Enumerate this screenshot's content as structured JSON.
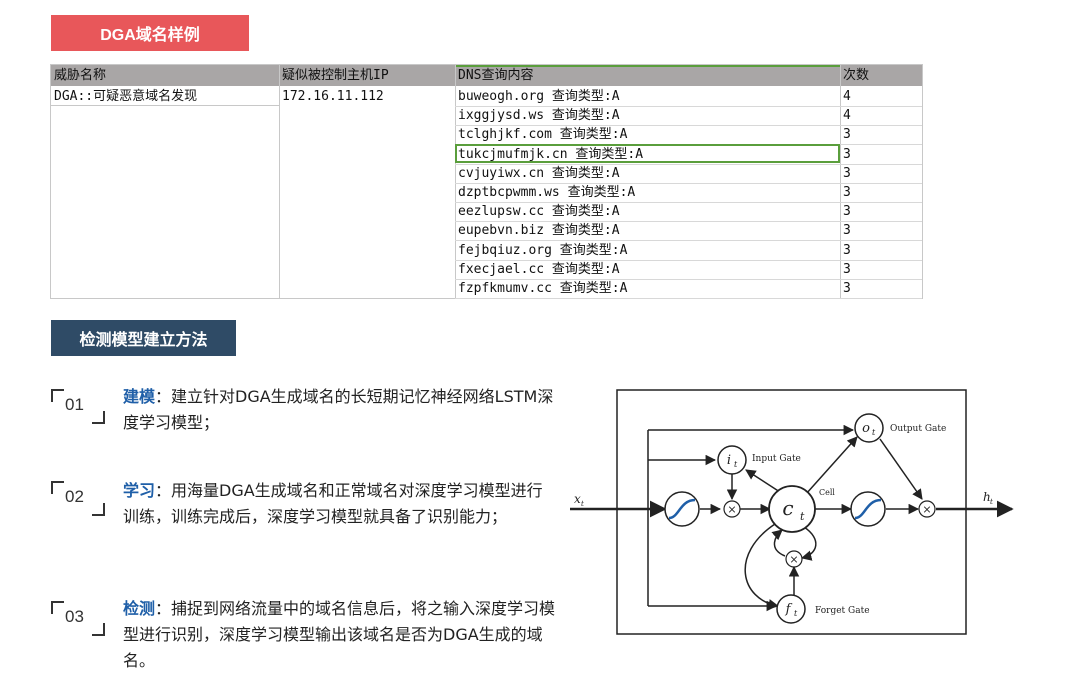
{
  "section1": {
    "title": "DGA域名样例"
  },
  "section2": {
    "title": "检测模型建立方法"
  },
  "table": {
    "headers": [
      "威胁名称",
      "疑似被控制主机IP",
      "DNS查询内容",
      "次数"
    ],
    "threat_name": "DGA::可疑恶意域名发现",
    "host_ip": "172.16.11.112",
    "rows": [
      {
        "query": "buweogh.org 查询类型:A",
        "count": "4"
      },
      {
        "query": "ixggjysd.ws 查询类型:A",
        "count": "4"
      },
      {
        "query": "tclghjkf.com 查询类型:A",
        "count": "3"
      },
      {
        "query": "tukcjmufmjk.cn 查询类型:A",
        "count": "3"
      },
      {
        "query": "cvjuyiwx.cn 查询类型:A",
        "count": "3"
      },
      {
        "query": "dzptbcpwmm.ws 查询类型:A",
        "count": "3"
      },
      {
        "query": "eezlupsw.cc 查询类型:A",
        "count": "3"
      },
      {
        "query": "eupebvn.biz 查询类型:A",
        "count": "3"
      },
      {
        "query": "fejbqiuz.org 查询类型:A",
        "count": "3"
      },
      {
        "query": "fxecjael.cc 查询类型:A",
        "count": "3"
      },
      {
        "query": "fzpfkmumv.cc 查询类型:A",
        "count": "3"
      }
    ]
  },
  "steps": [
    {
      "num": "01",
      "title": "建模",
      "text": "：建立针对DGA生成域名的长短期记忆神经网络LSTM深度学习模型；"
    },
    {
      "num": "02",
      "title": "学习",
      "text": "：用海量DGA生成域名和正常域名对深度学习模型进行训练，训练完成后，深度学习模型就具备了识别能力；"
    },
    {
      "num": "03",
      "title": "检测",
      "text": "：捕捉到网络流量中的域名信息后，将之输入深度学习模型进行识别，深度学习模型输出该域名是否为DGA生成的域名。"
    }
  ],
  "diagram": {
    "input_label": "x",
    "input_sub": "t",
    "output_label": "h",
    "output_sub": "t",
    "cell_label": "c",
    "cell_sub": "t",
    "cell_caption": "Cell",
    "input_gate_node": "i",
    "input_gate_sub": "t",
    "input_gate_label": "Input Gate",
    "output_gate_node": "o",
    "output_gate_sub": "t",
    "output_gate_label": "Output Gate",
    "forget_gate_node": "f",
    "forget_gate_sub": "t",
    "forget_gate_label": "Forget Gate",
    "multiply_symbol": "×"
  }
}
